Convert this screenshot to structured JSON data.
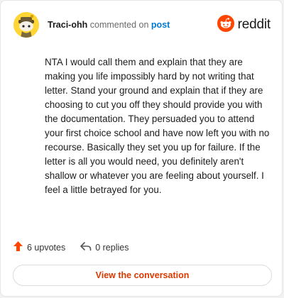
{
  "header": {
    "username": "Traci-ohh",
    "action_text": "commented on",
    "post_link": "post",
    "brand_name": "reddit"
  },
  "comment": {
    "text": "NTA I would call them and explain that they are making you life impossibly hard by not writing that letter. Stand your ground and explain that if they are choosing to cut you off they should provide you with the documentation. They persuaded you to attend your first choice school and have now left you with no recourse. Basically they set you up for failure. If the letter is all you would need, you definitely aren't shallow or whatever you are feeling about yourself. I feel a little betrayed for you."
  },
  "stats": {
    "upvotes_label": "6 upvotes",
    "replies_label": "0 replies"
  },
  "cta": {
    "label": "View the conversation"
  },
  "colors": {
    "brand_orange": "#ff4500",
    "upvote_orange": "#ff4500",
    "link_blue": "#0079d3",
    "cta_text": "#d93a00",
    "avatar_bg": "#ffd635"
  },
  "icons": {
    "avatar": "snoo-avatar-icon",
    "brand": "reddit-logo-icon",
    "upvote": "upvote-arrow-icon",
    "reply": "reply-arrow-icon"
  }
}
